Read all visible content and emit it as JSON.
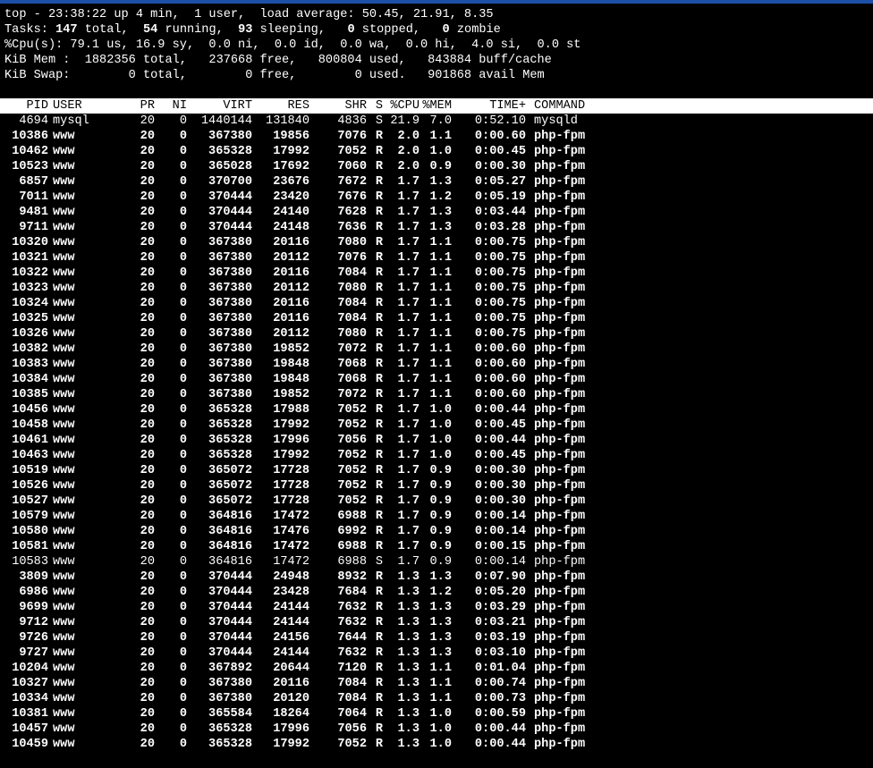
{
  "window": {
    "accent_color": "#1d4fa8"
  },
  "summary": {
    "line1": "top - 23:38:22 up 4 min,  1 user,  load average: 50.45, 21.91, 8.35",
    "line2_prefix": "Tasks: ",
    "tasks_total": "147",
    "line2_mid1": " total,  ",
    "tasks_running": "54",
    "line2_mid2": " running,  ",
    "tasks_sleeping": "93",
    "line2_mid3": " sleeping,   ",
    "tasks_stopped": "0",
    "line2_mid4": " stopped,   ",
    "tasks_zombie": "0",
    "line2_suffix": " zombie",
    "line3": "%Cpu(s): 79.1 us, 16.9 sy,  0.0 ni,  0.0 id,  0.0 wa,  0.0 hi,  4.0 si,  0.0 st",
    "line4": "KiB Mem :  1882356 total,   237668 free,   800804 used,   843884 buff/cache",
    "line5": "KiB Swap:        0 total,        0 free,        0 used.   901868 avail Mem"
  },
  "table": {
    "headers": {
      "pid": "PID",
      "user": "USER",
      "pr": "PR",
      "ni": "NI",
      "virt": "VIRT",
      "res": "RES",
      "shr": "SHR",
      "s": "S",
      "cpu": "%CPU",
      "mem": "%MEM",
      "time": "TIME+",
      "cmd": "COMMAND"
    },
    "rows": [
      {
        "pid": "4694",
        "user": "mysql",
        "pr": "20",
        "ni": "0",
        "virt": "1440144",
        "res": "131840",
        "shr": "4836",
        "s": "S",
        "cpu": "21.9",
        "mem": "7.0",
        "time": "0:52.10",
        "cmd": "mysqld"
      },
      {
        "pid": "10386",
        "user": "www",
        "pr": "20",
        "ni": "0",
        "virt": "367380",
        "res": "19856",
        "shr": "7076",
        "s": "R",
        "cpu": "2.0",
        "mem": "1.1",
        "time": "0:00.60",
        "cmd": "php-fpm"
      },
      {
        "pid": "10462",
        "user": "www",
        "pr": "20",
        "ni": "0",
        "virt": "365328",
        "res": "17992",
        "shr": "7052",
        "s": "R",
        "cpu": "2.0",
        "mem": "1.0",
        "time": "0:00.45",
        "cmd": "php-fpm"
      },
      {
        "pid": "10523",
        "user": "www",
        "pr": "20",
        "ni": "0",
        "virt": "365028",
        "res": "17692",
        "shr": "7060",
        "s": "R",
        "cpu": "2.0",
        "mem": "0.9",
        "time": "0:00.30",
        "cmd": "php-fpm"
      },
      {
        "pid": "6857",
        "user": "www",
        "pr": "20",
        "ni": "0",
        "virt": "370700",
        "res": "23676",
        "shr": "7672",
        "s": "R",
        "cpu": "1.7",
        "mem": "1.3",
        "time": "0:05.27",
        "cmd": "php-fpm"
      },
      {
        "pid": "7011",
        "user": "www",
        "pr": "20",
        "ni": "0",
        "virt": "370444",
        "res": "23420",
        "shr": "7676",
        "s": "R",
        "cpu": "1.7",
        "mem": "1.2",
        "time": "0:05.19",
        "cmd": "php-fpm"
      },
      {
        "pid": "9481",
        "user": "www",
        "pr": "20",
        "ni": "0",
        "virt": "370444",
        "res": "24140",
        "shr": "7628",
        "s": "R",
        "cpu": "1.7",
        "mem": "1.3",
        "time": "0:03.44",
        "cmd": "php-fpm"
      },
      {
        "pid": "9711",
        "user": "www",
        "pr": "20",
        "ni": "0",
        "virt": "370444",
        "res": "24148",
        "shr": "7636",
        "s": "R",
        "cpu": "1.7",
        "mem": "1.3",
        "time": "0:03.28",
        "cmd": "php-fpm"
      },
      {
        "pid": "10320",
        "user": "www",
        "pr": "20",
        "ni": "0",
        "virt": "367380",
        "res": "20116",
        "shr": "7080",
        "s": "R",
        "cpu": "1.7",
        "mem": "1.1",
        "time": "0:00.75",
        "cmd": "php-fpm"
      },
      {
        "pid": "10321",
        "user": "www",
        "pr": "20",
        "ni": "0",
        "virt": "367380",
        "res": "20112",
        "shr": "7076",
        "s": "R",
        "cpu": "1.7",
        "mem": "1.1",
        "time": "0:00.75",
        "cmd": "php-fpm"
      },
      {
        "pid": "10322",
        "user": "www",
        "pr": "20",
        "ni": "0",
        "virt": "367380",
        "res": "20116",
        "shr": "7084",
        "s": "R",
        "cpu": "1.7",
        "mem": "1.1",
        "time": "0:00.75",
        "cmd": "php-fpm"
      },
      {
        "pid": "10323",
        "user": "www",
        "pr": "20",
        "ni": "0",
        "virt": "367380",
        "res": "20112",
        "shr": "7080",
        "s": "R",
        "cpu": "1.7",
        "mem": "1.1",
        "time": "0:00.75",
        "cmd": "php-fpm"
      },
      {
        "pid": "10324",
        "user": "www",
        "pr": "20",
        "ni": "0",
        "virt": "367380",
        "res": "20116",
        "shr": "7084",
        "s": "R",
        "cpu": "1.7",
        "mem": "1.1",
        "time": "0:00.75",
        "cmd": "php-fpm"
      },
      {
        "pid": "10325",
        "user": "www",
        "pr": "20",
        "ni": "0",
        "virt": "367380",
        "res": "20116",
        "shr": "7084",
        "s": "R",
        "cpu": "1.7",
        "mem": "1.1",
        "time": "0:00.75",
        "cmd": "php-fpm"
      },
      {
        "pid": "10326",
        "user": "www",
        "pr": "20",
        "ni": "0",
        "virt": "367380",
        "res": "20112",
        "shr": "7080",
        "s": "R",
        "cpu": "1.7",
        "mem": "1.1",
        "time": "0:00.75",
        "cmd": "php-fpm"
      },
      {
        "pid": "10382",
        "user": "www",
        "pr": "20",
        "ni": "0",
        "virt": "367380",
        "res": "19852",
        "shr": "7072",
        "s": "R",
        "cpu": "1.7",
        "mem": "1.1",
        "time": "0:00.60",
        "cmd": "php-fpm"
      },
      {
        "pid": "10383",
        "user": "www",
        "pr": "20",
        "ni": "0",
        "virt": "367380",
        "res": "19848",
        "shr": "7068",
        "s": "R",
        "cpu": "1.7",
        "mem": "1.1",
        "time": "0:00.60",
        "cmd": "php-fpm"
      },
      {
        "pid": "10384",
        "user": "www",
        "pr": "20",
        "ni": "0",
        "virt": "367380",
        "res": "19848",
        "shr": "7068",
        "s": "R",
        "cpu": "1.7",
        "mem": "1.1",
        "time": "0:00.60",
        "cmd": "php-fpm"
      },
      {
        "pid": "10385",
        "user": "www",
        "pr": "20",
        "ni": "0",
        "virt": "367380",
        "res": "19852",
        "shr": "7072",
        "s": "R",
        "cpu": "1.7",
        "mem": "1.1",
        "time": "0:00.60",
        "cmd": "php-fpm"
      },
      {
        "pid": "10456",
        "user": "www",
        "pr": "20",
        "ni": "0",
        "virt": "365328",
        "res": "17988",
        "shr": "7052",
        "s": "R",
        "cpu": "1.7",
        "mem": "1.0",
        "time": "0:00.44",
        "cmd": "php-fpm"
      },
      {
        "pid": "10458",
        "user": "www",
        "pr": "20",
        "ni": "0",
        "virt": "365328",
        "res": "17992",
        "shr": "7052",
        "s": "R",
        "cpu": "1.7",
        "mem": "1.0",
        "time": "0:00.45",
        "cmd": "php-fpm"
      },
      {
        "pid": "10461",
        "user": "www",
        "pr": "20",
        "ni": "0",
        "virt": "365328",
        "res": "17996",
        "shr": "7056",
        "s": "R",
        "cpu": "1.7",
        "mem": "1.0",
        "time": "0:00.44",
        "cmd": "php-fpm"
      },
      {
        "pid": "10463",
        "user": "www",
        "pr": "20",
        "ni": "0",
        "virt": "365328",
        "res": "17992",
        "shr": "7052",
        "s": "R",
        "cpu": "1.7",
        "mem": "1.0",
        "time": "0:00.45",
        "cmd": "php-fpm"
      },
      {
        "pid": "10519",
        "user": "www",
        "pr": "20",
        "ni": "0",
        "virt": "365072",
        "res": "17728",
        "shr": "7052",
        "s": "R",
        "cpu": "1.7",
        "mem": "0.9",
        "time": "0:00.30",
        "cmd": "php-fpm"
      },
      {
        "pid": "10526",
        "user": "www",
        "pr": "20",
        "ni": "0",
        "virt": "365072",
        "res": "17728",
        "shr": "7052",
        "s": "R",
        "cpu": "1.7",
        "mem": "0.9",
        "time": "0:00.30",
        "cmd": "php-fpm"
      },
      {
        "pid": "10527",
        "user": "www",
        "pr": "20",
        "ni": "0",
        "virt": "365072",
        "res": "17728",
        "shr": "7052",
        "s": "R",
        "cpu": "1.7",
        "mem": "0.9",
        "time": "0:00.30",
        "cmd": "php-fpm"
      },
      {
        "pid": "10579",
        "user": "www",
        "pr": "20",
        "ni": "0",
        "virt": "364816",
        "res": "17472",
        "shr": "6988",
        "s": "R",
        "cpu": "1.7",
        "mem": "0.9",
        "time": "0:00.14",
        "cmd": "php-fpm"
      },
      {
        "pid": "10580",
        "user": "www",
        "pr": "20",
        "ni": "0",
        "virt": "364816",
        "res": "17476",
        "shr": "6992",
        "s": "R",
        "cpu": "1.7",
        "mem": "0.9",
        "time": "0:00.14",
        "cmd": "php-fpm"
      },
      {
        "pid": "10581",
        "user": "www",
        "pr": "20",
        "ni": "0",
        "virt": "364816",
        "res": "17472",
        "shr": "6988",
        "s": "R",
        "cpu": "1.7",
        "mem": "0.9",
        "time": "0:00.15",
        "cmd": "php-fpm"
      },
      {
        "pid": "10583",
        "user": "www",
        "pr": "20",
        "ni": "0",
        "virt": "364816",
        "res": "17472",
        "shr": "6988",
        "s": "S",
        "cpu": "1.7",
        "mem": "0.9",
        "time": "0:00.14",
        "cmd": "php-fpm"
      },
      {
        "pid": "3809",
        "user": "www",
        "pr": "20",
        "ni": "0",
        "virt": "370444",
        "res": "24948",
        "shr": "8932",
        "s": "R",
        "cpu": "1.3",
        "mem": "1.3",
        "time": "0:07.90",
        "cmd": "php-fpm"
      },
      {
        "pid": "6986",
        "user": "www",
        "pr": "20",
        "ni": "0",
        "virt": "370444",
        "res": "23428",
        "shr": "7684",
        "s": "R",
        "cpu": "1.3",
        "mem": "1.2",
        "time": "0:05.20",
        "cmd": "php-fpm"
      },
      {
        "pid": "9699",
        "user": "www",
        "pr": "20",
        "ni": "0",
        "virt": "370444",
        "res": "24144",
        "shr": "7632",
        "s": "R",
        "cpu": "1.3",
        "mem": "1.3",
        "time": "0:03.29",
        "cmd": "php-fpm"
      },
      {
        "pid": "9712",
        "user": "www",
        "pr": "20",
        "ni": "0",
        "virt": "370444",
        "res": "24144",
        "shr": "7632",
        "s": "R",
        "cpu": "1.3",
        "mem": "1.3",
        "time": "0:03.21",
        "cmd": "php-fpm"
      },
      {
        "pid": "9726",
        "user": "www",
        "pr": "20",
        "ni": "0",
        "virt": "370444",
        "res": "24156",
        "shr": "7644",
        "s": "R",
        "cpu": "1.3",
        "mem": "1.3",
        "time": "0:03.19",
        "cmd": "php-fpm"
      },
      {
        "pid": "9727",
        "user": "www",
        "pr": "20",
        "ni": "0",
        "virt": "370444",
        "res": "24144",
        "shr": "7632",
        "s": "R",
        "cpu": "1.3",
        "mem": "1.3",
        "time": "0:03.10",
        "cmd": "php-fpm"
      },
      {
        "pid": "10204",
        "user": "www",
        "pr": "20",
        "ni": "0",
        "virt": "367892",
        "res": "20644",
        "shr": "7120",
        "s": "R",
        "cpu": "1.3",
        "mem": "1.1",
        "time": "0:01.04",
        "cmd": "php-fpm"
      },
      {
        "pid": "10327",
        "user": "www",
        "pr": "20",
        "ni": "0",
        "virt": "367380",
        "res": "20116",
        "shr": "7084",
        "s": "R",
        "cpu": "1.3",
        "mem": "1.1",
        "time": "0:00.74",
        "cmd": "php-fpm"
      },
      {
        "pid": "10334",
        "user": "www",
        "pr": "20",
        "ni": "0",
        "virt": "367380",
        "res": "20120",
        "shr": "7084",
        "s": "R",
        "cpu": "1.3",
        "mem": "1.1",
        "time": "0:00.73",
        "cmd": "php-fpm"
      },
      {
        "pid": "10381",
        "user": "www",
        "pr": "20",
        "ni": "0",
        "virt": "365584",
        "res": "18264",
        "shr": "7064",
        "s": "R",
        "cpu": "1.3",
        "mem": "1.0",
        "time": "0:00.59",
        "cmd": "php-fpm"
      },
      {
        "pid": "10457",
        "user": "www",
        "pr": "20",
        "ni": "0",
        "virt": "365328",
        "res": "17996",
        "shr": "7056",
        "s": "R",
        "cpu": "1.3",
        "mem": "1.0",
        "time": "0:00.44",
        "cmd": "php-fpm"
      },
      {
        "pid": "10459",
        "user": "www",
        "pr": "20",
        "ni": "0",
        "virt": "365328",
        "res": "17992",
        "shr": "7052",
        "s": "R",
        "cpu": "1.3",
        "mem": "1.0",
        "time": "0:00.44",
        "cmd": "php-fpm"
      }
    ]
  }
}
